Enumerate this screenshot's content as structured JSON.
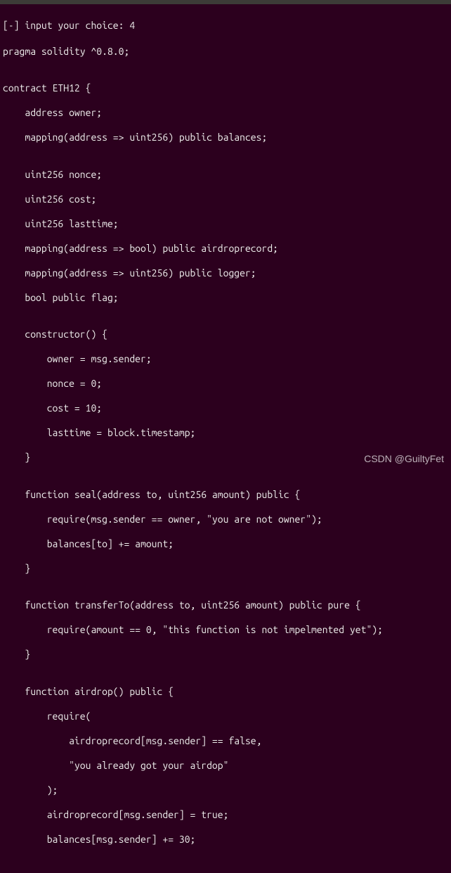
{
  "prompt": "[-] input your choice: 4",
  "code": {
    "l01": "pragma solidity ^0.8.0;",
    "l02": "",
    "l03": "contract ETH12 {",
    "l04": "    address owner;",
    "l05": "    mapping(address => uint256) public balances;",
    "l06": "",
    "l07": "    uint256 nonce;",
    "l08": "    uint256 cost;",
    "l09": "    uint256 lasttime;",
    "l10": "    mapping(address => bool) public airdroprecord;",
    "l11": "    mapping(address => uint256) public logger;",
    "l12": "    bool public flag;",
    "l13": "",
    "l14": "    constructor() {",
    "l15": "        owner = msg.sender;",
    "l16": "        nonce = 0;",
    "l17": "        cost = 10;",
    "l18": "        lasttime = block.timestamp;",
    "l19": "    }",
    "l20": "",
    "l21": "    function seal(address to, uint256 amount) public {",
    "l22": "        require(msg.sender == owner, \"you are not owner\");",
    "l23": "        balances[to] += amount;",
    "l24": "    }",
    "l25": "",
    "l26": "    function transferTo(address to, uint256 amount) public pure {",
    "l27": "        require(amount == 0, \"this function is not impelmented yet\");",
    "l28": "    }",
    "l29": "",
    "l30": "    function airdrop() public {",
    "l31": "        require(",
    "l32": "            airdroprecord[msg.sender] == false,",
    "l33": "            \"you already got your airdop\"",
    "l34": "        );",
    "l35": "        airdroprecord[msg.sender] = true;",
    "l36": "        balances[msg.sender] += 30;"
  },
  "watermark": "CSDN @GuiltyFet"
}
